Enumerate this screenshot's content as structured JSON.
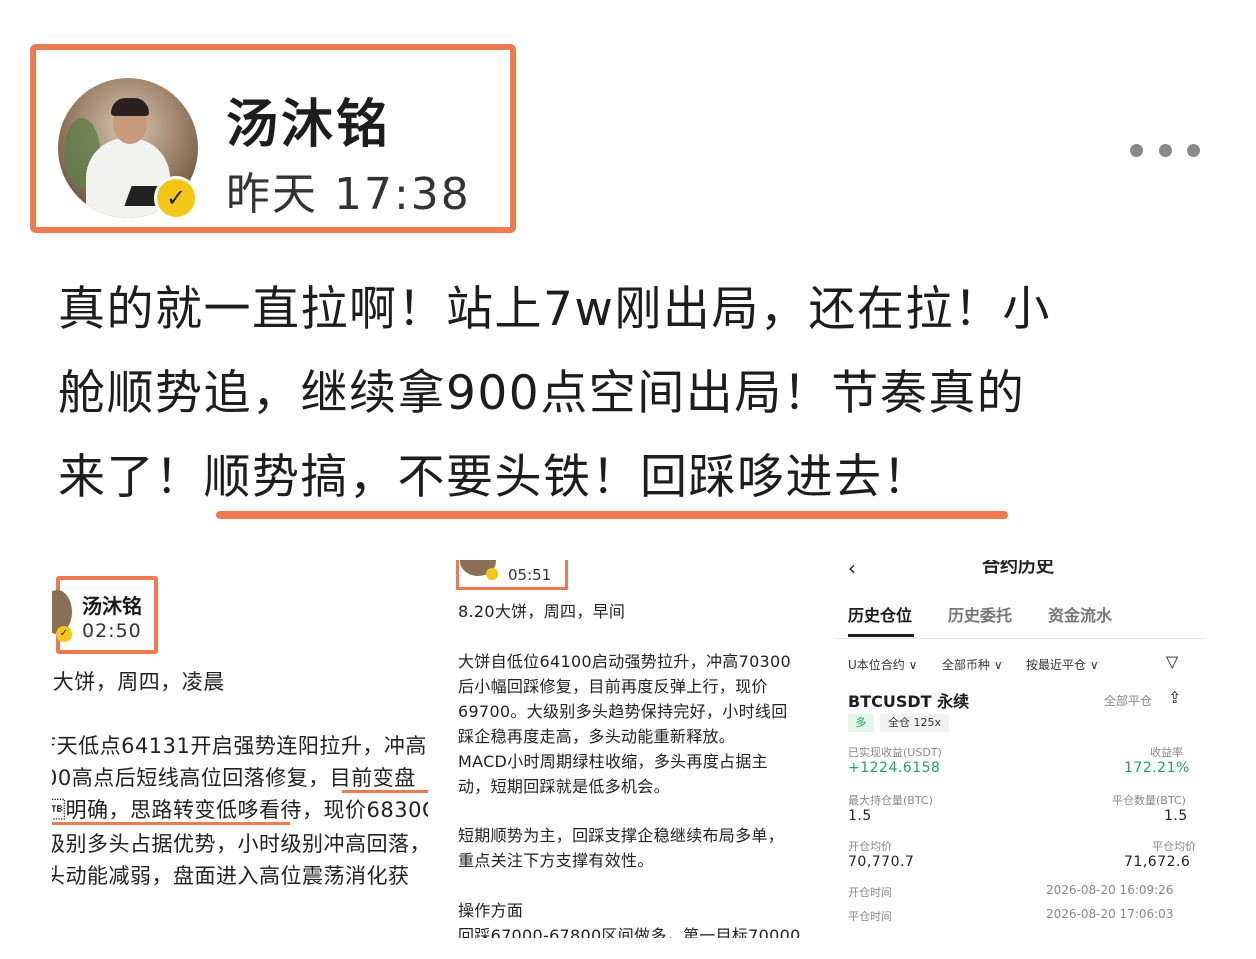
{
  "header": {
    "author_name": "汤沐铭",
    "post_time": "昨天 17:38"
  },
  "post": {
    "line1": "真的就一直拉啊！站上7w刚出局，还在拉！小",
    "line2": "舱顺势追，继续拿900点空间出局！节奏真的",
    "line3": "来了！顺势搞，不要头铁！回踩哆进去！"
  },
  "image1": {
    "author_name": "汤沐铭",
    "time": "02:50",
    "heading": ")大饼，周四，凌晨",
    "lines": [
      "F天低点64131开启强势连阳拉升，冲高",
      "00高点后短线高位回落修复，目前变盘",
      "\u0017明确，思路转变低哆看待，现价6830C",
      "级别多头占据优势，小时级别冲高回落，",
      "头动能减弱，盘面进入高位震荡消化获"
    ]
  },
  "image2": {
    "time": "05:51",
    "heading": "8.20大饼，周四，早间",
    "para1": [
      "大饼自低位64100启动强势拉升，冲高70300",
      "后小幅回踩修复，目前再度反弹上行，现价",
      "69700。大级别多头趋势保持完好，小时线回",
      "踩企稳再度走高，多头动能重新释放。",
      "MACD小时周期绿柱收缩，多头再度占据主",
      "动，短期回踩就是低多机会。"
    ],
    "para2": [
      "短期顺势为主，回踩支撑企稳继续布局多单，",
      "重点关注下方支撑有效性。"
    ],
    "para3": [
      "操作方面",
      "回踩67000-67800区间做多，第一目标70000"
    ]
  },
  "image3": {
    "title": "合约历史",
    "tabs": [
      "历史仓位",
      "历史委托",
      "资金流水"
    ],
    "filters": [
      "U本位合约 ∨",
      "全部币种 ∨",
      "按最近平仓 ∨"
    ],
    "symbol": "BTCUSDT 永续",
    "close_all": "全部平仓",
    "side_tag": "多",
    "leverage_tag": "全仓 125x",
    "realized_pnl_label": "已实现收益(USDT)",
    "realized_pnl": "+1224.6158",
    "roi_label": "收益率",
    "roi": "172.21%",
    "max_hold_label": "最大持仓量(BTC)",
    "max_hold": "1.5",
    "close_qty_label": "平仓数量(BTC)",
    "close_qty": "1.5",
    "open_avg_label": "开仓均价",
    "open_avg": "70,770.7",
    "close_avg_label": "平仓均价",
    "close_avg": "71,672.6",
    "open_time_label": "开仓时间",
    "open_time": "2026-08-20 16:09:26",
    "close_time_label": "平仓时间",
    "close_time": "2026-08-20 17:06:03"
  },
  "colors": {
    "accent": "#f07a4f",
    "profit_green": "#1ea35a",
    "badge_yellow": "#f5c518"
  }
}
